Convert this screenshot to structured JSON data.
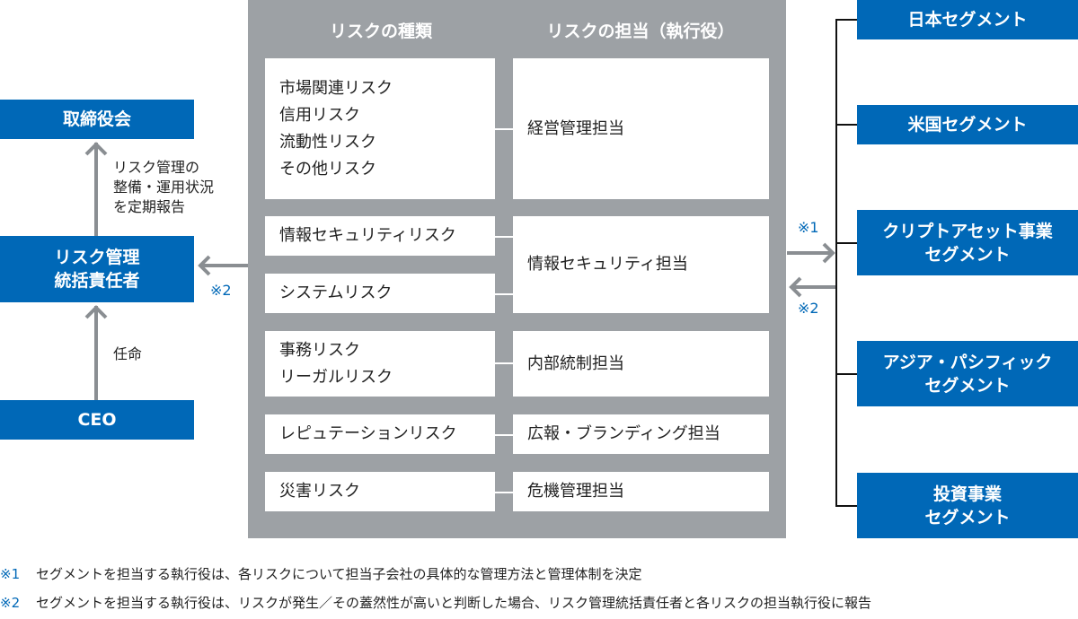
{
  "left": {
    "board": "取締役会",
    "risk_officer": [
      "リスク管理",
      "統括責任者"
    ],
    "ceo": "CEO",
    "report_label": [
      "リスク管理の",
      "整備・運用状況",
      "を定期報告"
    ],
    "appoint_label": "任命",
    "arrow_mark": "※2"
  },
  "panel": {
    "header_types": "リスクの種類",
    "header_owner": "リスクの担当（執行役）",
    "groups": [
      {
        "risks": [
          [
            "市場関連リスク",
            "信用リスク",
            "流動性リスク",
            "その他リスク"
          ]
        ],
        "owner": "経営管理担当"
      },
      {
        "risks": [
          [
            "情報セキュリティリスク"
          ],
          [
            "システムリスク"
          ]
        ],
        "owner": "情報セキュリティ担当"
      },
      {
        "risks": [
          [
            "事務リスク",
            "リーガルリスク"
          ]
        ],
        "owner": "内部統制担当"
      },
      {
        "risks": [
          [
            "レピュテーションリスク"
          ]
        ],
        "owner": "広報・ブランディング担当"
      },
      {
        "risks": [
          [
            "災害リスク"
          ]
        ],
        "owner": "危機管理担当"
      }
    ]
  },
  "right": {
    "mark1": "※1",
    "mark2": "※2",
    "segments": [
      [
        "日本セグメント"
      ],
      [
        "米国セグメント"
      ],
      [
        "クリプトアセット事業",
        "セグメント"
      ],
      [
        "アジア・パシフィック",
        "セグメント"
      ],
      [
        "投資事業",
        "セグメント"
      ]
    ]
  },
  "footnotes": [
    {
      "mark": "※1",
      "text": "セグメントを担当する執行役は、各リスクについて担当子会社の具体的な管理方法と管理体制を決定"
    },
    {
      "mark": "※2",
      "text": "セグメントを担当する執行役は、リスクが発生／その蓋然性が高いと判断した場合、リスク管理統括責任者と各リスクの担当執行役に報告"
    }
  ],
  "colors": {
    "blue": "#0068b7",
    "panel_grey": "#9da1a5",
    "arrow_grey": "#8a8e92"
  }
}
